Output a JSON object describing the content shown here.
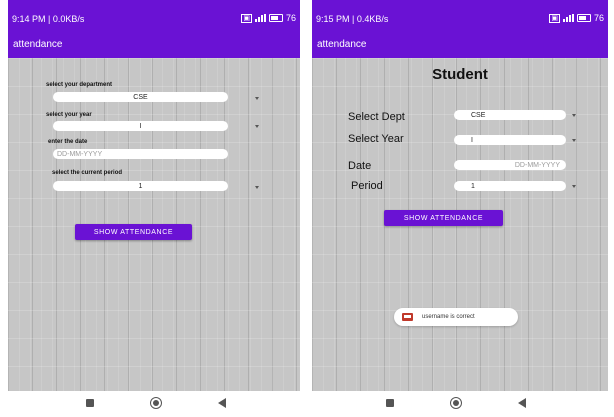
{
  "left_screen": {
    "status": {
      "time_text": "9:14 PM | 0.0KB/s",
      "battery": "76"
    },
    "app_title": "attendance",
    "form": {
      "department_label": "select your department",
      "department_value": "CSE",
      "year_label": "select your year",
      "year_value": "I",
      "date_label": "enter the date",
      "date_placeholder": "DD-MM-YYYY",
      "period_label": "select the current period",
      "period_value": "1",
      "show_button": "SHOW ATTENDANCE"
    }
  },
  "right_screen": {
    "status": {
      "time_text": "9:15 PM | 0.4KB/s",
      "battery": "76"
    },
    "app_title": "attendance",
    "heading": "Student",
    "form": {
      "dept_label": "Select Dept",
      "dept_value": "CSE",
      "year_label": "Select Year",
      "year_value": "I",
      "date_label": "Date",
      "date_placeholder": "DD-MM-YYYY",
      "period_label": "Period",
      "period_value": "1",
      "show_button": "SHOW ATTENDANCE"
    },
    "toast": "username is correct"
  },
  "colors": {
    "primary": "#6a12d4",
    "toast_icon": "#c0392b"
  }
}
